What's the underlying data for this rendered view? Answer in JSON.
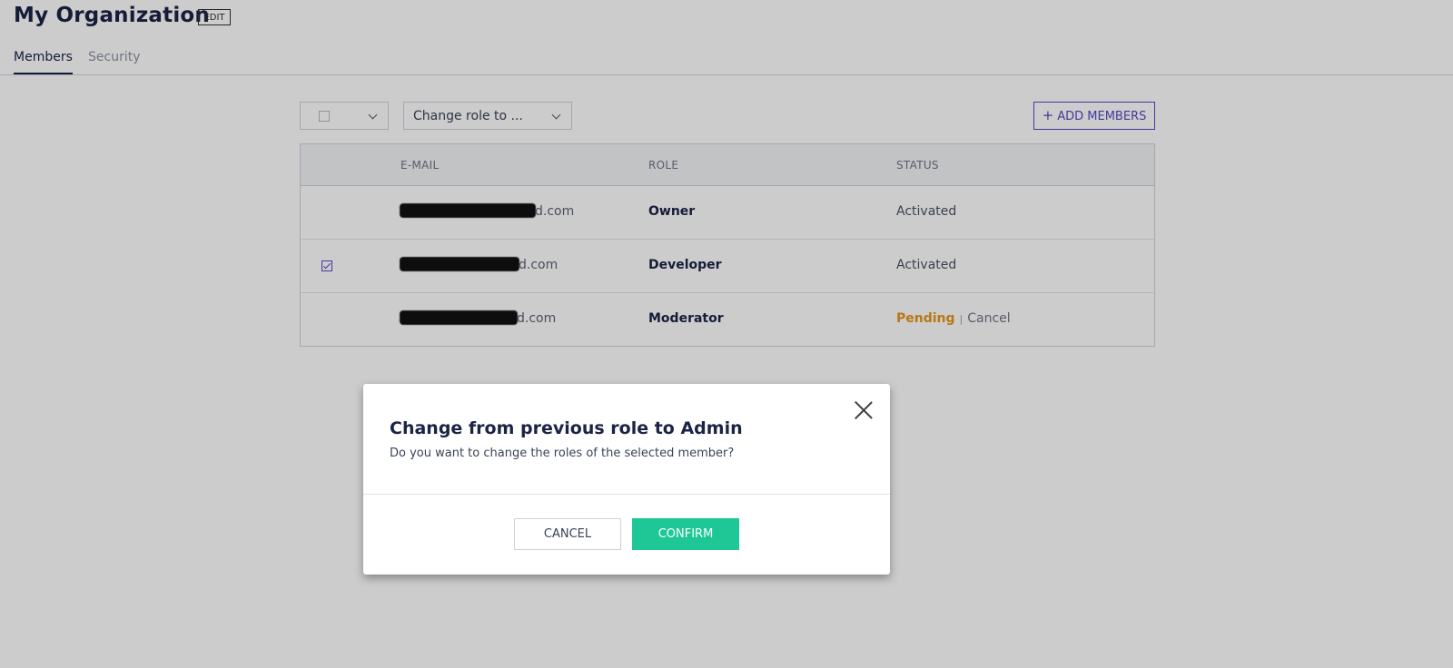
{
  "header": {
    "title": "My Organization",
    "edit_label": "EDIT"
  },
  "tabs": [
    {
      "label": "Members",
      "active": true
    },
    {
      "label": "Security",
      "active": false
    }
  ],
  "toolbar": {
    "select_all_checked": false,
    "role_select_value": "Change role to ...",
    "add_members_label": "ADD MEMBERS",
    "add_icon": "plus-icon"
  },
  "table": {
    "columns": [
      "E-MAIL",
      "ROLE",
      "STATUS"
    ],
    "rows": [
      {
        "checked": false,
        "email_suffix": "d.com",
        "role": "Owner",
        "status": "Activated"
      },
      {
        "checked": true,
        "email_suffix": "d.com",
        "role": "Developer",
        "status": "Activated"
      },
      {
        "checked": false,
        "email_suffix": "d.com",
        "role": "Moderator",
        "status": "Pending",
        "status_action": "Cancel"
      }
    ]
  },
  "modal": {
    "title": "Change from previous role to Admin",
    "text": "Do you want to change the roles of the selected member?",
    "cancel_label": "CANCEL",
    "confirm_label": "CONFIRM",
    "close_icon": "close-icon"
  },
  "colors": {
    "accent": "#5548c8",
    "confirm": "#1ec896",
    "pending": "#e69519",
    "title": "#1b2347"
  }
}
